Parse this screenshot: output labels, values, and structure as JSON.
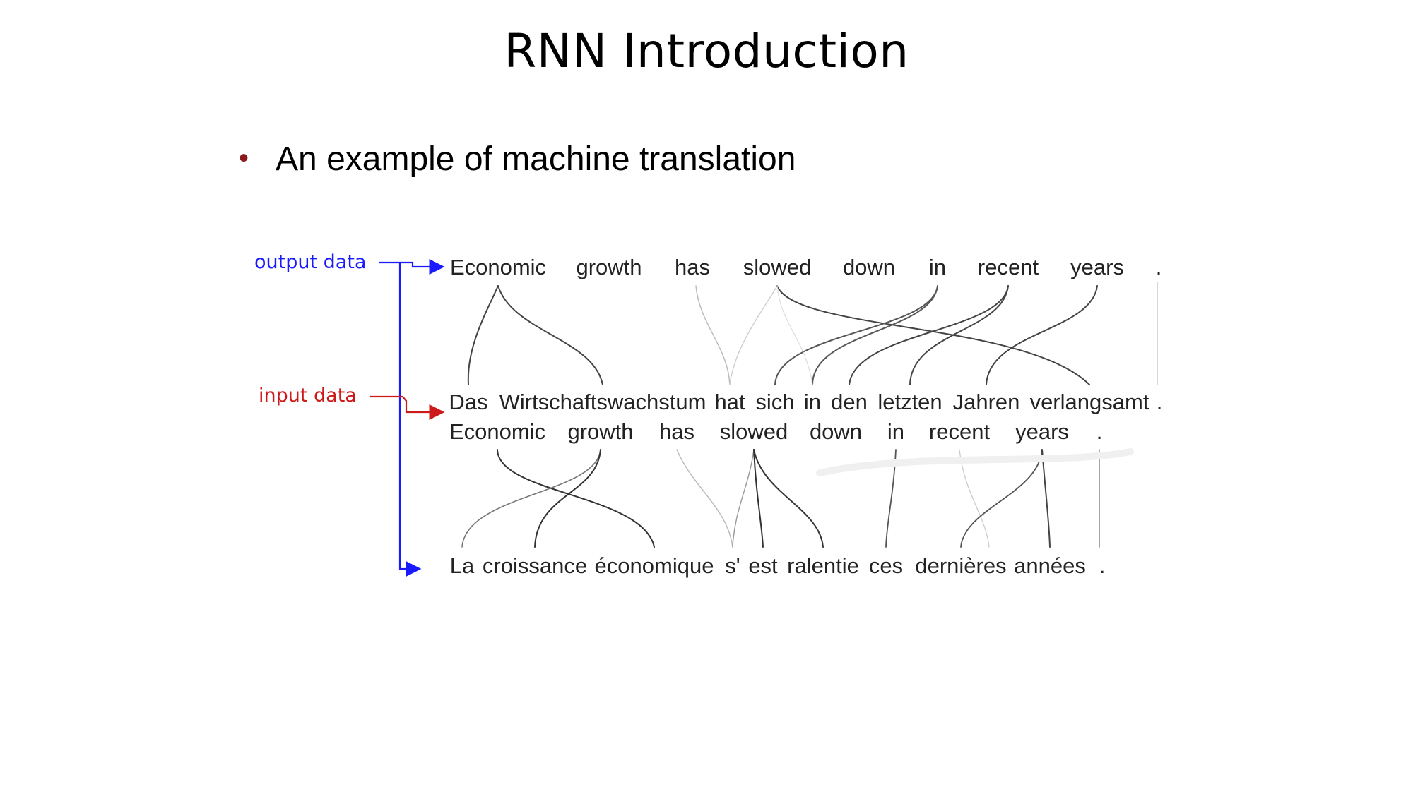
{
  "slide": {
    "title": "RNN Introduction",
    "bullet": "An example of machine translation"
  },
  "labels": {
    "output": "output data",
    "input": "input data",
    "output_color": "#1a1aff",
    "input_color": "#cc1a1a"
  },
  "alignment_1": {
    "target_words": [
      "Economic",
      "growth",
      "has",
      "slowed",
      "down",
      "in",
      "recent",
      "years",
      "."
    ],
    "source_words": [
      "Das",
      "Wirtschaftswachstum",
      "hat",
      "sich",
      "in",
      "den",
      "letzten",
      "Jahren",
      "verlangsamt",
      "."
    ]
  },
  "alignment_2": {
    "source_words": [
      "Economic",
      "growth",
      "has",
      "slowed",
      "down",
      "in",
      "recent",
      "years",
      "."
    ],
    "target_words": [
      "La",
      "croissance",
      "économique",
      "s'",
      "est",
      "ralentie",
      "ces",
      "dernières",
      "années",
      "."
    ]
  }
}
